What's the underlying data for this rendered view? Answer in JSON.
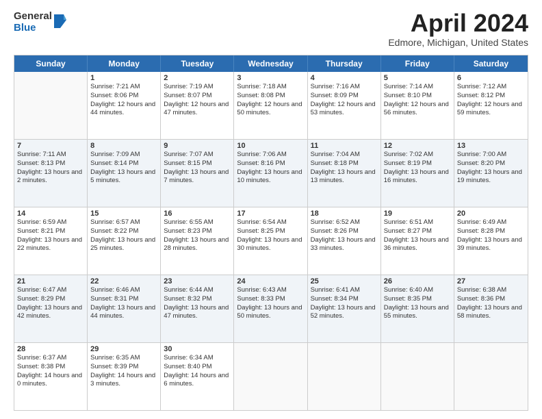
{
  "logo": {
    "general": "General",
    "blue": "Blue"
  },
  "title": {
    "month": "April 2024",
    "location": "Edmore, Michigan, United States"
  },
  "header_days": [
    "Sunday",
    "Monday",
    "Tuesday",
    "Wednesday",
    "Thursday",
    "Friday",
    "Saturday"
  ],
  "weeks": [
    [
      {
        "day": "",
        "sunrise": "",
        "sunset": "",
        "daylight": "",
        "shaded": false,
        "empty": true
      },
      {
        "day": "1",
        "sunrise": "Sunrise: 7:21 AM",
        "sunset": "Sunset: 8:06 PM",
        "daylight": "Daylight: 12 hours and 44 minutes.",
        "shaded": false,
        "empty": false
      },
      {
        "day": "2",
        "sunrise": "Sunrise: 7:19 AM",
        "sunset": "Sunset: 8:07 PM",
        "daylight": "Daylight: 12 hours and 47 minutes.",
        "shaded": false,
        "empty": false
      },
      {
        "day": "3",
        "sunrise": "Sunrise: 7:18 AM",
        "sunset": "Sunset: 8:08 PM",
        "daylight": "Daylight: 12 hours and 50 minutes.",
        "shaded": false,
        "empty": false
      },
      {
        "day": "4",
        "sunrise": "Sunrise: 7:16 AM",
        "sunset": "Sunset: 8:09 PM",
        "daylight": "Daylight: 12 hours and 53 minutes.",
        "shaded": false,
        "empty": false
      },
      {
        "day": "5",
        "sunrise": "Sunrise: 7:14 AM",
        "sunset": "Sunset: 8:10 PM",
        "daylight": "Daylight: 12 hours and 56 minutes.",
        "shaded": false,
        "empty": false
      },
      {
        "day": "6",
        "sunrise": "Sunrise: 7:12 AM",
        "sunset": "Sunset: 8:12 PM",
        "daylight": "Daylight: 12 hours and 59 minutes.",
        "shaded": false,
        "empty": false
      }
    ],
    [
      {
        "day": "7",
        "sunrise": "Sunrise: 7:11 AM",
        "sunset": "Sunset: 8:13 PM",
        "daylight": "Daylight: 13 hours and 2 minutes.",
        "shaded": true,
        "empty": false
      },
      {
        "day": "8",
        "sunrise": "Sunrise: 7:09 AM",
        "sunset": "Sunset: 8:14 PM",
        "daylight": "Daylight: 13 hours and 5 minutes.",
        "shaded": true,
        "empty": false
      },
      {
        "day": "9",
        "sunrise": "Sunrise: 7:07 AM",
        "sunset": "Sunset: 8:15 PM",
        "daylight": "Daylight: 13 hours and 7 minutes.",
        "shaded": true,
        "empty": false
      },
      {
        "day": "10",
        "sunrise": "Sunrise: 7:06 AM",
        "sunset": "Sunset: 8:16 PM",
        "daylight": "Daylight: 13 hours and 10 minutes.",
        "shaded": true,
        "empty": false
      },
      {
        "day": "11",
        "sunrise": "Sunrise: 7:04 AM",
        "sunset": "Sunset: 8:18 PM",
        "daylight": "Daylight: 13 hours and 13 minutes.",
        "shaded": true,
        "empty": false
      },
      {
        "day": "12",
        "sunrise": "Sunrise: 7:02 AM",
        "sunset": "Sunset: 8:19 PM",
        "daylight": "Daylight: 13 hours and 16 minutes.",
        "shaded": true,
        "empty": false
      },
      {
        "day": "13",
        "sunrise": "Sunrise: 7:00 AM",
        "sunset": "Sunset: 8:20 PM",
        "daylight": "Daylight: 13 hours and 19 minutes.",
        "shaded": true,
        "empty": false
      }
    ],
    [
      {
        "day": "14",
        "sunrise": "Sunrise: 6:59 AM",
        "sunset": "Sunset: 8:21 PM",
        "daylight": "Daylight: 13 hours and 22 minutes.",
        "shaded": false,
        "empty": false
      },
      {
        "day": "15",
        "sunrise": "Sunrise: 6:57 AM",
        "sunset": "Sunset: 8:22 PM",
        "daylight": "Daylight: 13 hours and 25 minutes.",
        "shaded": false,
        "empty": false
      },
      {
        "day": "16",
        "sunrise": "Sunrise: 6:55 AM",
        "sunset": "Sunset: 8:23 PM",
        "daylight": "Daylight: 13 hours and 28 minutes.",
        "shaded": false,
        "empty": false
      },
      {
        "day": "17",
        "sunrise": "Sunrise: 6:54 AM",
        "sunset": "Sunset: 8:25 PM",
        "daylight": "Daylight: 13 hours and 30 minutes.",
        "shaded": false,
        "empty": false
      },
      {
        "day": "18",
        "sunrise": "Sunrise: 6:52 AM",
        "sunset": "Sunset: 8:26 PM",
        "daylight": "Daylight: 13 hours and 33 minutes.",
        "shaded": false,
        "empty": false
      },
      {
        "day": "19",
        "sunrise": "Sunrise: 6:51 AM",
        "sunset": "Sunset: 8:27 PM",
        "daylight": "Daylight: 13 hours and 36 minutes.",
        "shaded": false,
        "empty": false
      },
      {
        "day": "20",
        "sunrise": "Sunrise: 6:49 AM",
        "sunset": "Sunset: 8:28 PM",
        "daylight": "Daylight: 13 hours and 39 minutes.",
        "shaded": false,
        "empty": false
      }
    ],
    [
      {
        "day": "21",
        "sunrise": "Sunrise: 6:47 AM",
        "sunset": "Sunset: 8:29 PM",
        "daylight": "Daylight: 13 hours and 42 minutes.",
        "shaded": true,
        "empty": false
      },
      {
        "day": "22",
        "sunrise": "Sunrise: 6:46 AM",
        "sunset": "Sunset: 8:31 PM",
        "daylight": "Daylight: 13 hours and 44 minutes.",
        "shaded": true,
        "empty": false
      },
      {
        "day": "23",
        "sunrise": "Sunrise: 6:44 AM",
        "sunset": "Sunset: 8:32 PM",
        "daylight": "Daylight: 13 hours and 47 minutes.",
        "shaded": true,
        "empty": false
      },
      {
        "day": "24",
        "sunrise": "Sunrise: 6:43 AM",
        "sunset": "Sunset: 8:33 PM",
        "daylight": "Daylight: 13 hours and 50 minutes.",
        "shaded": true,
        "empty": false
      },
      {
        "day": "25",
        "sunrise": "Sunrise: 6:41 AM",
        "sunset": "Sunset: 8:34 PM",
        "daylight": "Daylight: 13 hours and 52 minutes.",
        "shaded": true,
        "empty": false
      },
      {
        "day": "26",
        "sunrise": "Sunrise: 6:40 AM",
        "sunset": "Sunset: 8:35 PM",
        "daylight": "Daylight: 13 hours and 55 minutes.",
        "shaded": true,
        "empty": false
      },
      {
        "day": "27",
        "sunrise": "Sunrise: 6:38 AM",
        "sunset": "Sunset: 8:36 PM",
        "daylight": "Daylight: 13 hours and 58 minutes.",
        "shaded": true,
        "empty": false
      }
    ],
    [
      {
        "day": "28",
        "sunrise": "Sunrise: 6:37 AM",
        "sunset": "Sunset: 8:38 PM",
        "daylight": "Daylight: 14 hours and 0 minutes.",
        "shaded": false,
        "empty": false
      },
      {
        "day": "29",
        "sunrise": "Sunrise: 6:35 AM",
        "sunset": "Sunset: 8:39 PM",
        "daylight": "Daylight: 14 hours and 3 minutes.",
        "shaded": false,
        "empty": false
      },
      {
        "day": "30",
        "sunrise": "Sunrise: 6:34 AM",
        "sunset": "Sunset: 8:40 PM",
        "daylight": "Daylight: 14 hours and 6 minutes.",
        "shaded": false,
        "empty": false
      },
      {
        "day": "",
        "sunrise": "",
        "sunset": "",
        "daylight": "",
        "shaded": false,
        "empty": true
      },
      {
        "day": "",
        "sunrise": "",
        "sunset": "",
        "daylight": "",
        "shaded": false,
        "empty": true
      },
      {
        "day": "",
        "sunrise": "",
        "sunset": "",
        "daylight": "",
        "shaded": false,
        "empty": true
      },
      {
        "day": "",
        "sunrise": "",
        "sunset": "",
        "daylight": "",
        "shaded": false,
        "empty": true
      }
    ]
  ]
}
